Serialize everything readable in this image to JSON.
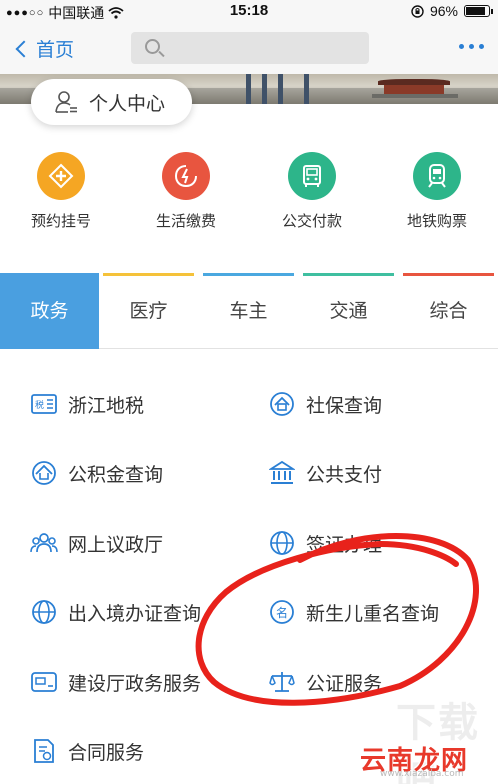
{
  "status_bar": {
    "carrier": "中国联通",
    "time": "15:18",
    "battery": "96%",
    "battery_level": 0.96
  },
  "nav": {
    "back_label": "首页",
    "search_placeholder": ""
  },
  "profile": {
    "label": "个人中心"
  },
  "quick_services": [
    {
      "label": "预约挂号",
      "color": "#f5a623",
      "icon": "medical-cross-icon"
    },
    {
      "label": "生活缴费",
      "color": "#e8553f",
      "icon": "payment-icon"
    },
    {
      "label": "公交付款",
      "color": "#2db58a",
      "icon": "bus-card-icon"
    },
    {
      "label": "地铁购票",
      "color": "#2db58a",
      "icon": "subway-icon"
    }
  ],
  "tabs": [
    {
      "label": "政务",
      "active": true,
      "bar_color": "#4a9fe0"
    },
    {
      "label": "医疗",
      "active": false,
      "bar_color": "#f5c23a"
    },
    {
      "label": "车主",
      "active": false,
      "bar_color": "#4aa8e0"
    },
    {
      "label": "交通",
      "active": false,
      "bar_color": "#3fbfa0"
    },
    {
      "label": "综合",
      "active": false,
      "bar_color": "#e8553f"
    }
  ],
  "services": [
    {
      "label": "浙江地税",
      "icon": "tax-icon"
    },
    {
      "label": "社保查询",
      "icon": "social-security-icon"
    },
    {
      "label": "公积金查询",
      "icon": "housing-fund-icon"
    },
    {
      "label": "公共支付",
      "icon": "bank-icon"
    },
    {
      "label": "网上议政厅",
      "icon": "people-icon"
    },
    {
      "label": "签证办理",
      "icon": "globe-icon"
    },
    {
      "label": "出入境办证查询",
      "icon": "globe-icon"
    },
    {
      "label": "新生儿重名查询",
      "icon": "name-search-icon"
    },
    {
      "label": "建设厅政务服务",
      "icon": "card-icon"
    },
    {
      "label": "公证服务",
      "icon": "scales-icon"
    },
    {
      "label": "合同服务",
      "icon": "contract-icon"
    }
  ],
  "watermark": {
    "brand": "云南龙网",
    "url": "www.xiazaiba.com"
  },
  "accent_color": "#2a7fd4",
  "annotation_color": "#e8221b"
}
